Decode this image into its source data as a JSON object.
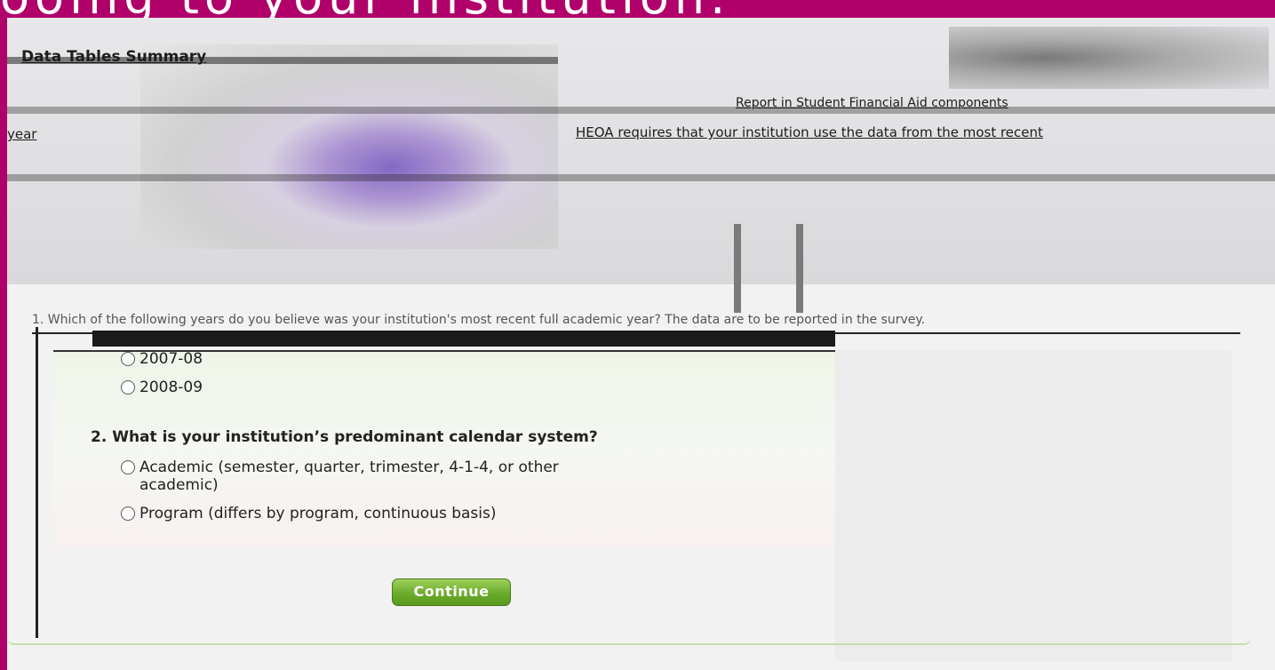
{
  "header": {
    "slide_title": "ooing to your institution."
  },
  "banner": {
    "heading": "Data Tables Summary",
    "line_hera": "HEOA requires that your institution use the data from the most recent",
    "line_prefix": "year",
    "line_top_right": "Report in Student Financial Aid components"
  },
  "form": {
    "question1_partial": "1. Which of the following years do you believe was your institution's most recent full academic year? The data are to be reported in the survey.",
    "q1_options": [
      "2007-08",
      "2008-09"
    ],
    "question2": "2. What is your institution’s predominant calendar system?",
    "q2_options": [
      {
        "line1": "Academic (semester, quarter, trimester, 4-1-4, or other",
        "line2": "academic)"
      },
      {
        "line1": "Program (differs by program, continuous basis)",
        "line2": ""
      }
    ],
    "continue_label": "Continue"
  },
  "colors": {
    "frame": "#b0006a",
    "button_green": "#6bab2a"
  }
}
